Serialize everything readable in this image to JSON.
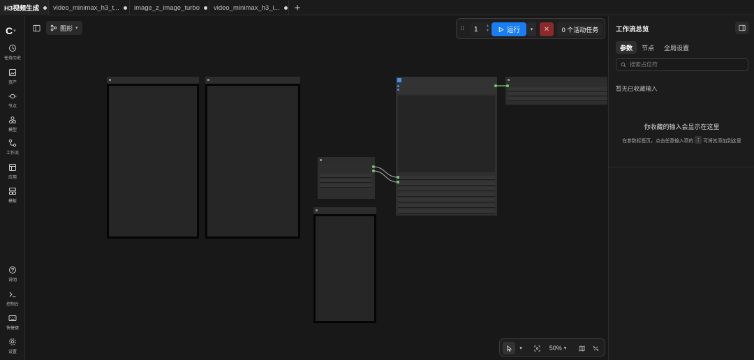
{
  "tabs": [
    {
      "label": "H3视频生成",
      "active": true
    },
    {
      "label": "video_minimax_h3_t...",
      "active": false
    },
    {
      "label": "image_z_image_turbo",
      "active": false
    },
    {
      "label": "video_minimax_h3_i...",
      "active": false
    }
  ],
  "tab_add_label": "+",
  "sidebar": {
    "logo": "C",
    "items": [
      {
        "label": "任务历史",
        "icon": "history-icon"
      },
      {
        "label": "资产",
        "icon": "image-icon"
      },
      {
        "label": "节点",
        "icon": "node-icon"
      },
      {
        "label": "模型",
        "icon": "model-icon"
      },
      {
        "label": "工作流",
        "icon": "workflow-icon"
      },
      {
        "label": "应用",
        "icon": "app-icon"
      },
      {
        "label": "模板",
        "icon": "template-icon"
      }
    ],
    "bottom_items": [
      {
        "label": "说明",
        "icon": "help-icon"
      },
      {
        "label": "控制台",
        "icon": "terminal-icon"
      },
      {
        "label": "快捷键",
        "icon": "keyboard-icon"
      },
      {
        "label": "设置",
        "icon": "settings-icon"
      }
    ]
  },
  "canvas": {
    "graph_mode_label": "图形"
  },
  "runbar": {
    "quantity": "1",
    "run_label": "运行",
    "stop_label": "✕",
    "active_tasks_label": "0 个活动任务"
  },
  "bottombar": {
    "zoom": "50%"
  },
  "right_panel": {
    "title": "工作流总览",
    "tabs": [
      "参数",
      "节点",
      "全局设置"
    ],
    "search_placeholder": "搜索占位符",
    "section_label": "暂无已收藏输入",
    "empty_title": "你收藏的输入会显示在这里",
    "empty_sub_before": "在参数标签页，点击任意输入项的",
    "empty_sub_kbd": "⋮",
    "empty_sub_after": "可将其添加到这里"
  },
  "colors": {
    "accent": "#1a7ef2",
    "stop": "#8a2a2a",
    "link": "#6fcf6f"
  }
}
